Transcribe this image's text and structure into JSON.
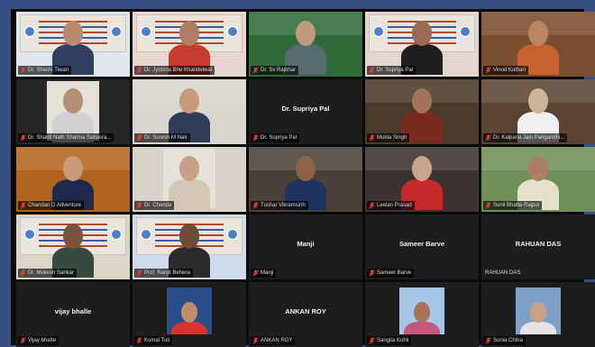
{
  "meeting": {
    "participants": [
      {
        "name": "Dr. Shashi Tiwari",
        "kind": "banner",
        "active": true,
        "bg": "#dfe6ef",
        "skin": "#b98a6e",
        "cloth": "#2f3e63"
      },
      {
        "name": "Dr. Jyotsna Bhe Khandelwal",
        "kind": "banner",
        "bg": "#e8d7d0",
        "skin": "#b07f63",
        "cloth": "#c73a2e"
      },
      {
        "name": "Dr. Sv Rajbhar",
        "kind": "green",
        "bg": "#2f6b3a",
        "skin": "#c09a7c",
        "cloth": "#556b6f"
      },
      {
        "name": "Dr. Supriya Pal",
        "kind": "banner",
        "bg": "#e3d6cf",
        "skin": "#9a6a52",
        "cloth": "#1e1e1e"
      },
      {
        "name": "Vinod Kothari",
        "kind": "room",
        "bg": "#7a4e2e",
        "skin": "#b9865f",
        "cloth": "#c9622f"
      },
      {
        "name": "Dr. Shanti Nath Sharma Sahasra...",
        "kind": "frame",
        "bg": "#272727",
        "skin": "#b38f78",
        "cloth": "#d0d0d0"
      },
      {
        "name": "Dr. Suresh M Nair",
        "kind": "room",
        "bg": "#d9d5cf",
        "skin": "#c89a7b",
        "cloth": "#2e3d55"
      },
      {
        "name": "Dr. Supriya Pal",
        "kind": "text",
        "label": "Dr. Supriya Pal"
      },
      {
        "name": "Mukta Singh",
        "kind": "temple",
        "bg": "#4a3a2c",
        "skin": "#a27457",
        "cloth": "#7b2a1f"
      },
      {
        "name": "Dr. Kalpana Jain Parigandhi...",
        "kind": "room",
        "bg": "#5b4433",
        "skin": "#d0b39b",
        "cloth": "#f0f0f0"
      },
      {
        "name": "Chandan D Adventure",
        "kind": "orange",
        "bg": "#b4631f",
        "skin": "#c79a7a",
        "cloth": "#1d2a4e"
      },
      {
        "name": "Dr. Chanda",
        "kind": "frame",
        "bg": "#d9d2c8",
        "skin": "#c7a187",
        "cloth": "#d3c7b6"
      },
      {
        "name": "Tushar Vikramsinh",
        "kind": "room",
        "bg": "#4b4038",
        "skin": "#8e6248",
        "cloth": "#1f3360"
      },
      {
        "name": "Leelan Prasad",
        "kind": "room",
        "bg": "#3b3330",
        "skin": "#c9a38d",
        "cloth": "#c42a2a"
      },
      {
        "name": "Sunil Bhatta Rajput",
        "kind": "green",
        "bg": "#6e8f58",
        "skin": "#ab7e5f",
        "cloth": "#e7e0c9"
      },
      {
        "name": "Dr. Mukesh Sankar",
        "kind": "banner",
        "bg": "#dcd3c9",
        "skin": "#7b5440",
        "cloth": "#364a40"
      },
      {
        "name": "Prof. Ranjit Behera",
        "kind": "banner",
        "bg": "#cfdbea",
        "skin": "#6e4a37",
        "cloth": "#2b2b2b"
      },
      {
        "name": "Manji",
        "kind": "text",
        "label": "Manji"
      },
      {
        "name": "Sameer Barve",
        "kind": "text",
        "label": "Sameer Barve"
      },
      {
        "name": "RAHUAN DAS",
        "kind": "text",
        "label": "RAHUAN DAS",
        "plain": true
      },
      {
        "name": "Vijay bhatte",
        "kind": "text",
        "label": "vijay bhalle"
      },
      {
        "name": "Komal Tuli",
        "kind": "avatar",
        "bg": "#2a4f88",
        "skin": "#c08e6c",
        "cloth": "#d6342d"
      },
      {
        "name": "ANKAN ROY",
        "kind": "text",
        "label": "ANKAN ROY"
      },
      {
        "name": "Sangita Kohli",
        "kind": "avatar",
        "bg": "#a7c7e8",
        "skin": "#a87456",
        "cloth": "#c7567f"
      },
      {
        "name": "Sonia Chitra",
        "kind": "avatar",
        "bg": "#7ea1c9",
        "skin": "#caa186",
        "cloth": "#e8e2e7"
      }
    ]
  },
  "colors": {
    "window_bg": "#3a4e86",
    "grid_bg": "#0b0b0b",
    "tile_bg": "#1d1d1d",
    "active_outline": "#d8c447",
    "mic_muted": "#e8412f"
  },
  "icons": {
    "mic": "mic-muted-icon"
  }
}
